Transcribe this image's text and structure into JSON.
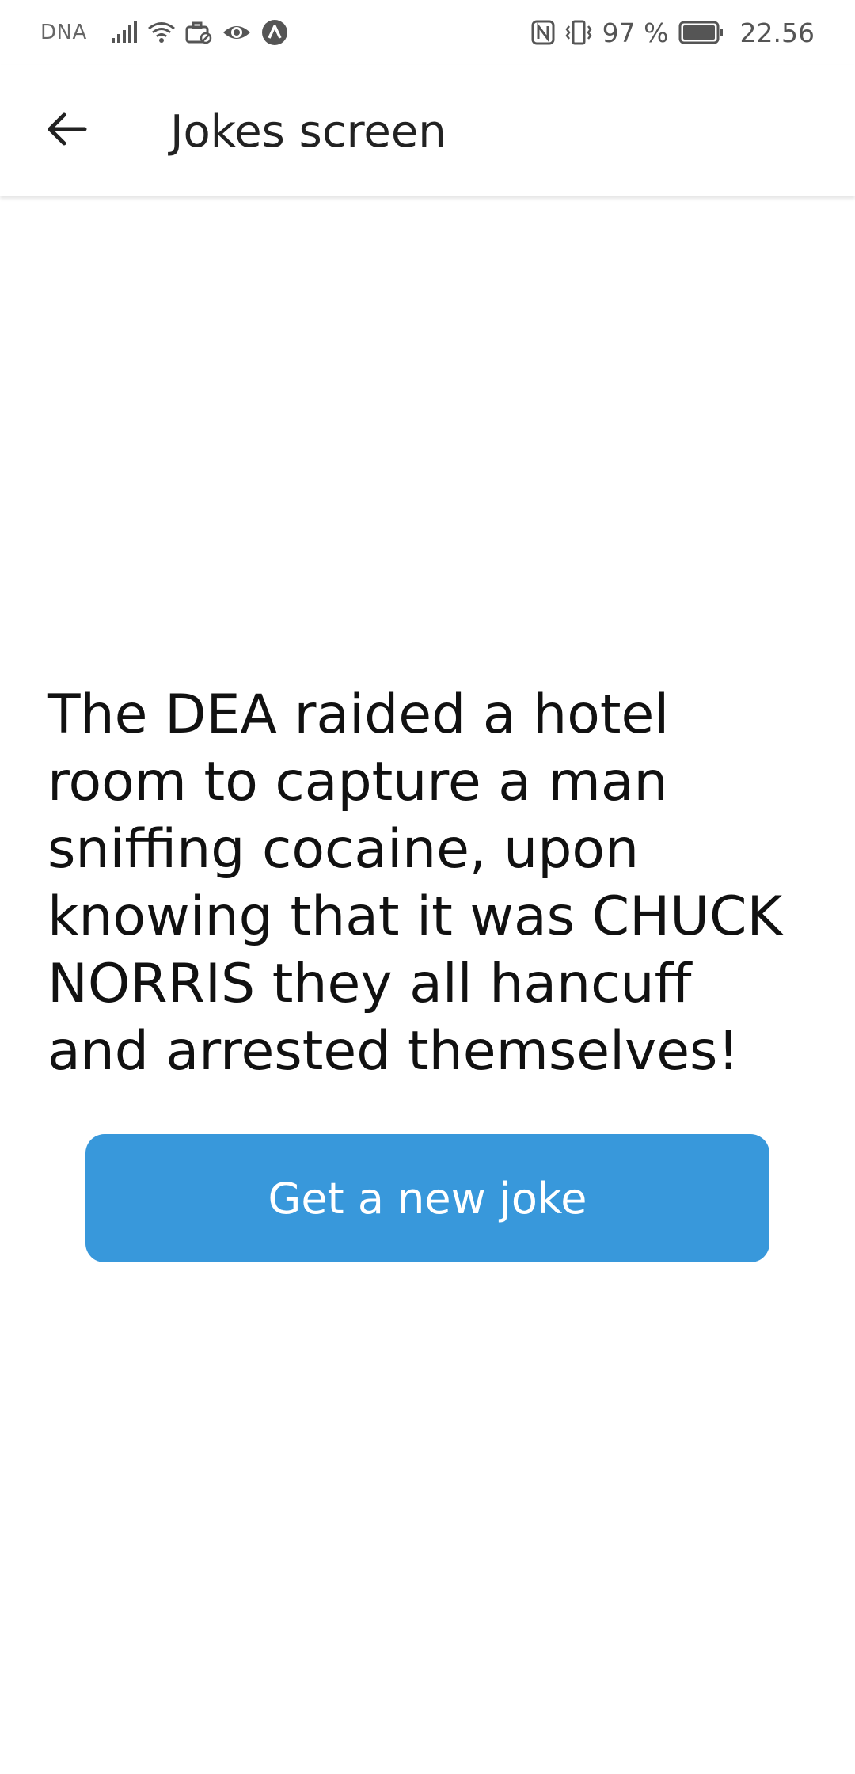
{
  "status_bar": {
    "carrier": "DNA",
    "battery_percent": "97 %",
    "time": "22.56"
  },
  "app_bar": {
    "title": "Jokes screen"
  },
  "joke": {
    "text": "The DEA raided a hotel room to capture a man sniffing cocaine, upon knowing that it was CHUCK NORRIS they all hancuff and arrested themselves!"
  },
  "actions": {
    "new_joke_label": "Get a new joke"
  },
  "colors": {
    "button": "#3898DB",
    "title_text": "#222222",
    "joke_text": "#111111"
  },
  "icons": [
    "signal-icon",
    "wifi-icon",
    "briefcase-icon",
    "eye-icon",
    "navigation-icon",
    "nfc-icon",
    "vibrate-icon",
    "battery-icon",
    "back-arrow-icon"
  ]
}
